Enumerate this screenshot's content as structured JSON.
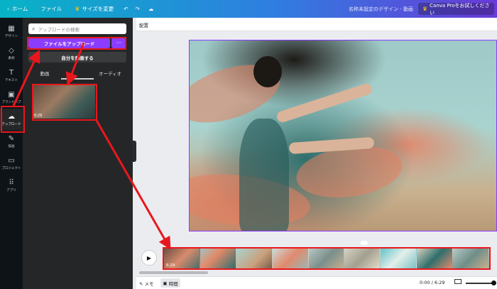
{
  "topbar": {
    "home": "ホーム",
    "file": "ファイル",
    "resize": "サイズを変更",
    "doc_title": "名称未設定のデザイン - 動画",
    "pro_label": "Canva Proをお試しください"
  },
  "sidebar": {
    "items": [
      {
        "label": "デザイン",
        "icon": "design-icon"
      },
      {
        "label": "素材",
        "icon": "elements-icon"
      },
      {
        "label": "テキスト",
        "icon": "text-icon"
      },
      {
        "label": "ブランドハブ",
        "icon": "brand-icon"
      },
      {
        "label": "アップロード",
        "icon": "upload-icon"
      },
      {
        "label": "描画",
        "icon": "draw-icon"
      },
      {
        "label": "プロジェクト",
        "icon": "folder-icon"
      },
      {
        "label": "アプリ",
        "icon": "apps-icon"
      }
    ]
  },
  "panel": {
    "search_placeholder": "アップロードの検索",
    "upload_button": "ファイルをアップロード",
    "more": "···",
    "record_button": "自分を録画する",
    "tabs": [
      "動画",
      "",
      "オーディオ"
    ],
    "thumb_duration": "6:29"
  },
  "toolbar": {
    "position_label": "配置"
  },
  "timeline": {
    "start_label": "6:29"
  },
  "bottom": {
    "memo": "メモ",
    "time": "時間",
    "clock": "0:00 / 6:29"
  },
  "colors": {
    "accent": "#8b3dff",
    "highlight": "#e8171d"
  }
}
